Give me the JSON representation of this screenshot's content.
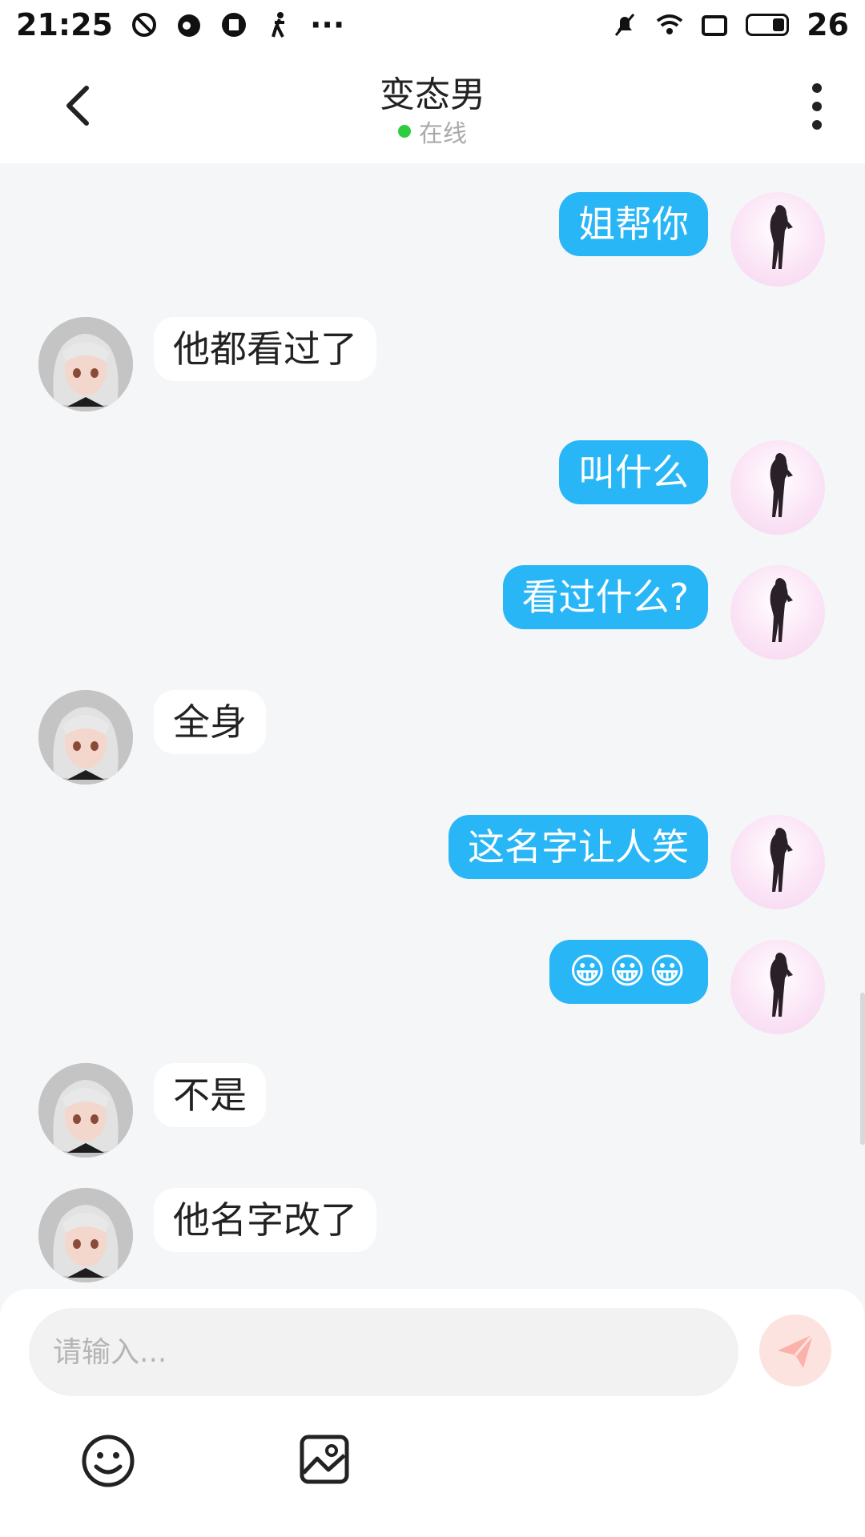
{
  "status_bar": {
    "time": "21:25",
    "battery": "26"
  },
  "header": {
    "title": "变态男",
    "status": "在线"
  },
  "messages": [
    {
      "side": "right",
      "text": "姐帮你"
    },
    {
      "side": "left",
      "text": "他都看过了"
    },
    {
      "side": "right",
      "text": "叫什么"
    },
    {
      "side": "right",
      "text": "看过什么?"
    },
    {
      "side": "left",
      "text": "全身"
    },
    {
      "side": "right",
      "text": "这名字让人笑"
    },
    {
      "side": "right",
      "text": "😀😀😀"
    },
    {
      "side": "left",
      "text": "不是"
    },
    {
      "side": "left",
      "text": "他名字改了"
    }
  ],
  "input": {
    "placeholder": "请输入..."
  },
  "colors": {
    "self_bubble": "#29b6f6",
    "other_bubble": "#ffffff",
    "online": "#2ecc40",
    "send_button": "#fde3e0"
  },
  "icons": {
    "back": "chevron-left-icon",
    "more": "more-vertical-icon",
    "send": "send-icon",
    "emoji": "emoji-icon",
    "image": "image-icon"
  }
}
